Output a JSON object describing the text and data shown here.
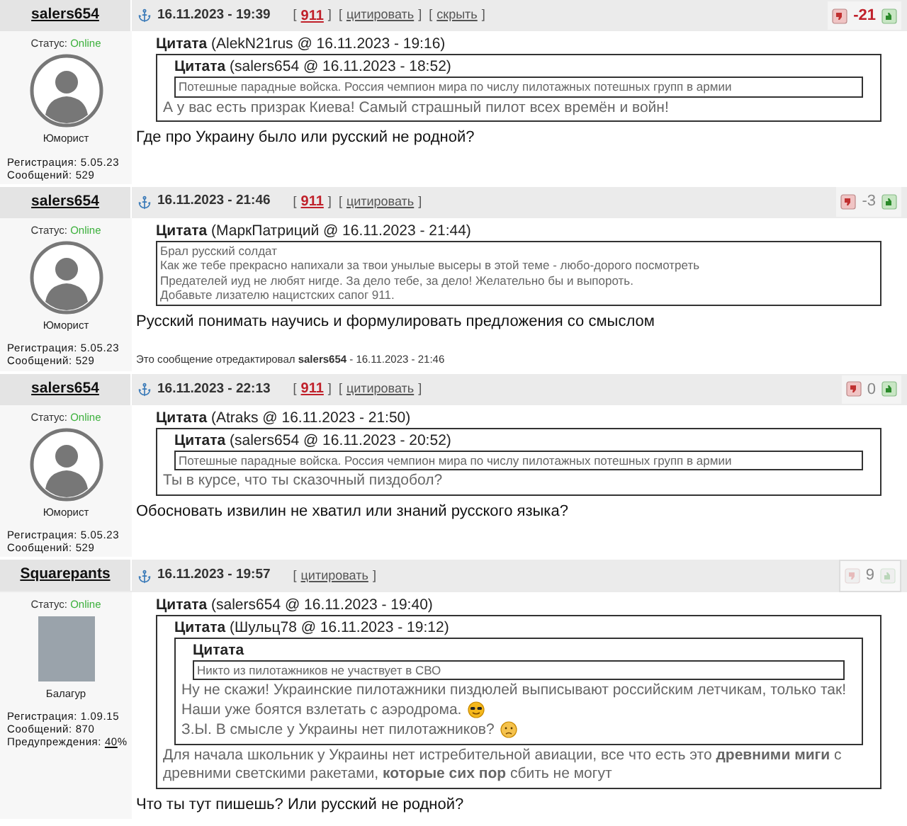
{
  "posts": [
    {
      "author": "salers654",
      "date": "16.11.2023 - 19:39",
      "actions": [
        {
          "kind": "report",
          "open": "[",
          "label": "911",
          "close": "]"
        },
        {
          "kind": "link",
          "open": "[",
          "label": "цитировать",
          "close": "]"
        },
        {
          "kind": "link",
          "open": "[",
          "label": "скрыть",
          "close": "]"
        }
      ],
      "rating": {
        "value": "-21",
        "kind": "negative",
        "enabled": true
      },
      "status_label": "Статус:",
      "status": "Online",
      "avatar": {
        "kind": "silhouette"
      },
      "rank": "Юморист",
      "meta": [
        {
          "label": "Регистрация:",
          "value": "5.05.23"
        },
        {
          "label": "Сообщений:",
          "value": "529"
        }
      ],
      "content": [
        {
          "kind": "quote",
          "title": "Цитата",
          "source": "(AlekN21rus @ 16.11.2023 - 19:16)",
          "content": [
            {
              "kind": "quote",
              "title": "Цитата",
              "source": "(salers654 @ 16.11.2023 - 18:52)",
              "content": [
                {
                  "kind": "text",
                  "text": "Потешные парадные войска. Россия чемпион мира по числу пилотажных потешных групп в армии"
                }
              ]
            },
            {
              "kind": "text",
              "text": "А у вас есть призрак Киева! Самый страшный пилот всех времён и войн!"
            }
          ]
        },
        {
          "kind": "post_text",
          "text": "Где про Украину было или русский не родной?"
        }
      ]
    },
    {
      "author": "salers654",
      "date": "16.11.2023 - 21:46",
      "actions": [
        {
          "kind": "report",
          "open": "[",
          "label": "911",
          "close": "]"
        },
        {
          "kind": "link",
          "open": "[",
          "label": "цитировать",
          "close": "]"
        }
      ],
      "rating": {
        "value": "-3",
        "kind": "neutral",
        "enabled": true
      },
      "status_label": "Статус:",
      "status": "Online",
      "avatar": {
        "kind": "silhouette"
      },
      "rank": "Юморист",
      "meta": [
        {
          "label": "Регистрация:",
          "value": "5.05.23"
        },
        {
          "label": "Сообщений:",
          "value": "529"
        }
      ],
      "content": [
        {
          "kind": "quote",
          "title": "Цитата",
          "source": "(МаркПатриций @ 16.11.2023 - 21:44)",
          "content": [
            {
              "kind": "text",
              "text": "Брал русский солдат"
            },
            {
              "kind": "text",
              "text": "Как же тебе прекрасно напихали за твои унылые высеры в этой теме - любо-дорого посмотреть"
            },
            {
              "kind": "text",
              "text": "Предателей иуд не любят нигде. За дело тебе, за дело! Желательно бы и выпороть."
            },
            {
              "kind": "text",
              "text": "Добавьте лизателю нацистских сапог 911."
            }
          ]
        },
        {
          "kind": "post_text",
          "text": "Русский понимать научись и формулировать предложения со смыслом"
        },
        {
          "kind": "edit_note",
          "text": "Это сообщение отредактировал **salers654** - 16.11.2023 - 21:46"
        }
      ]
    },
    {
      "author": "salers654",
      "date": "16.11.2023 - 22:13",
      "actions": [
        {
          "kind": "report",
          "open": "[",
          "label": "911",
          "close": "]"
        },
        {
          "kind": "link",
          "open": "[",
          "label": "цитировать",
          "close": "]"
        }
      ],
      "rating": {
        "value": "0",
        "kind": "neutral",
        "enabled": true
      },
      "status_label": "Статус:",
      "status": "Online",
      "avatar": {
        "kind": "silhouette"
      },
      "rank": "Юморист",
      "meta": [
        {
          "label": "Регистрация:",
          "value": "5.05.23"
        },
        {
          "label": "Сообщений:",
          "value": "529"
        }
      ],
      "content": [
        {
          "kind": "quote",
          "title": "Цитата",
          "source": "(Atraks @ 16.11.2023 - 21:50)",
          "content": [
            {
              "kind": "quote",
              "title": "Цитата",
              "source": "(salers654 @ 16.11.2023 - 20:52)",
              "content": [
                {
                  "kind": "text",
                  "text": "Потешные парадные войска. Россия чемпион мира по числу пилотажных потешных групп в армии"
                }
              ]
            },
            {
              "kind": "text",
              "text": "Ты в курсе, что ты сказочный пиздобол?"
            }
          ]
        },
        {
          "kind": "post_text",
          "text": "Обосновать извилин не хватил или знаний русского языка?"
        }
      ]
    },
    {
      "author": "Squarepants",
      "date": "16.11.2023 - 19:57",
      "actions": [
        {
          "kind": "link",
          "open": "[",
          "label": "цитировать",
          "close": "]"
        }
      ],
      "rating": {
        "value": "9",
        "kind": "neutral",
        "enabled": false
      },
      "status_label": "Статус:",
      "status": "Online",
      "avatar": {
        "kind": "photo"
      },
      "rank": "Балагур",
      "meta": [
        {
          "label": "Регистрация:",
          "value": "1.09.15"
        },
        {
          "label": "Сообщений:",
          "value": "870"
        },
        {
          "label": "Предупреждения:",
          "value": "40",
          "suffix": "%",
          "link": true
        }
      ],
      "content": [
        {
          "kind": "quote",
          "title": "Цитата",
          "source": "(salers654 @ 16.11.2023 - 19:40)",
          "content": [
            {
              "kind": "quote",
              "title": "Цитата",
              "source": "(Шульц78 @ 16.11.2023 - 19:12)",
              "content": [
                {
                  "kind": "quote",
                  "title": "Цитата",
                  "content": [
                    {
                      "kind": "text",
                      "text": "Никто из пилотажников не участвует в СВО"
                    }
                  ]
                },
                {
                  "kind": "text",
                  "text": "Ну не скажи! Украинские пилотажники пиздюлей выписывают российским летчикам, только так! Наши уже боятся взлетать с аэродрома.",
                  "emoji": {
                    "kind": "cool"
                  }
                },
                {
                  "kind": "text",
                  "text": "З.Ы. В смысле у Украины нет пилотажников?",
                  "emoji": {
                    "kind": "sad"
                  }
                }
              ]
            },
            {
              "kind": "text",
              "text": "Для начала школьник у Украины нет истребительной авиации, все что есть это **древними миги** с древними светскими ракетами, **которые сих пор** сбить не могут"
            }
          ]
        },
        {
          "kind": "post_text",
          "text": "Что ты тут пишешь? Или русский не родной?"
        }
      ]
    }
  ]
}
